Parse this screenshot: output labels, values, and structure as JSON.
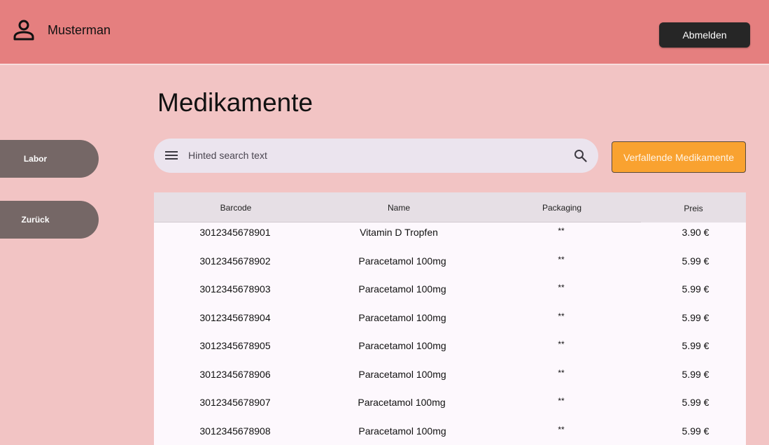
{
  "header": {
    "username": "Musterman",
    "logout_label": "Abmelden"
  },
  "page": {
    "title": "Medikamente"
  },
  "sidebar": {
    "items": [
      {
        "label": "Labor"
      },
      {
        "label": "Zurück"
      }
    ]
  },
  "search": {
    "placeholder": "Hinted search text"
  },
  "actions": {
    "expiring_label": "Verfallende Medikamente"
  },
  "table": {
    "columns": [
      "Barcode",
      "Name",
      "Packaging",
      "Preis"
    ],
    "rows": [
      {
        "barcode": "3012345678901",
        "name": "Vitamin D Tropfen",
        "packaging": "**",
        "price": "3.90 €"
      },
      {
        "barcode": "3012345678902",
        "name": "Paracetamol 100mg",
        "packaging": "**",
        "price": "5.99 €"
      },
      {
        "barcode": "3012345678903",
        "name": "Paracetamol 100mg",
        "packaging": "**",
        "price": "5.99 €"
      },
      {
        "barcode": "3012345678904",
        "name": "Paracetamol 100mg",
        "packaging": "**",
        "price": "5.99 €"
      },
      {
        "barcode": "3012345678905",
        "name": "Paracetamol 100mg",
        "packaging": "**",
        "price": "5.99 €"
      },
      {
        "barcode": "3012345678906",
        "name": "Paracetamol 100mg",
        "packaging": "**",
        "price": "5.99 €"
      },
      {
        "barcode": "3012345678907",
        "name": "Paracetamol 100mg",
        "packaging": "**",
        "price": "5.99 €"
      },
      {
        "barcode": "3012345678908",
        "name": "Paracetamol 100mg",
        "packaging": "**",
        "price": "5.99 €"
      }
    ]
  },
  "icons": {
    "user": "user-icon",
    "menu": "menu-icon",
    "search": "search-icon"
  },
  "colors": {
    "header": "#e57f7f",
    "background": "#f2c4c4",
    "nav_button": "#756766",
    "logout_button": "#262626",
    "expiring_button": "#f9a230",
    "search_bar": "#ebe4ee",
    "table_header": "#e6dfe5",
    "table_body": "#fdf8fd"
  }
}
